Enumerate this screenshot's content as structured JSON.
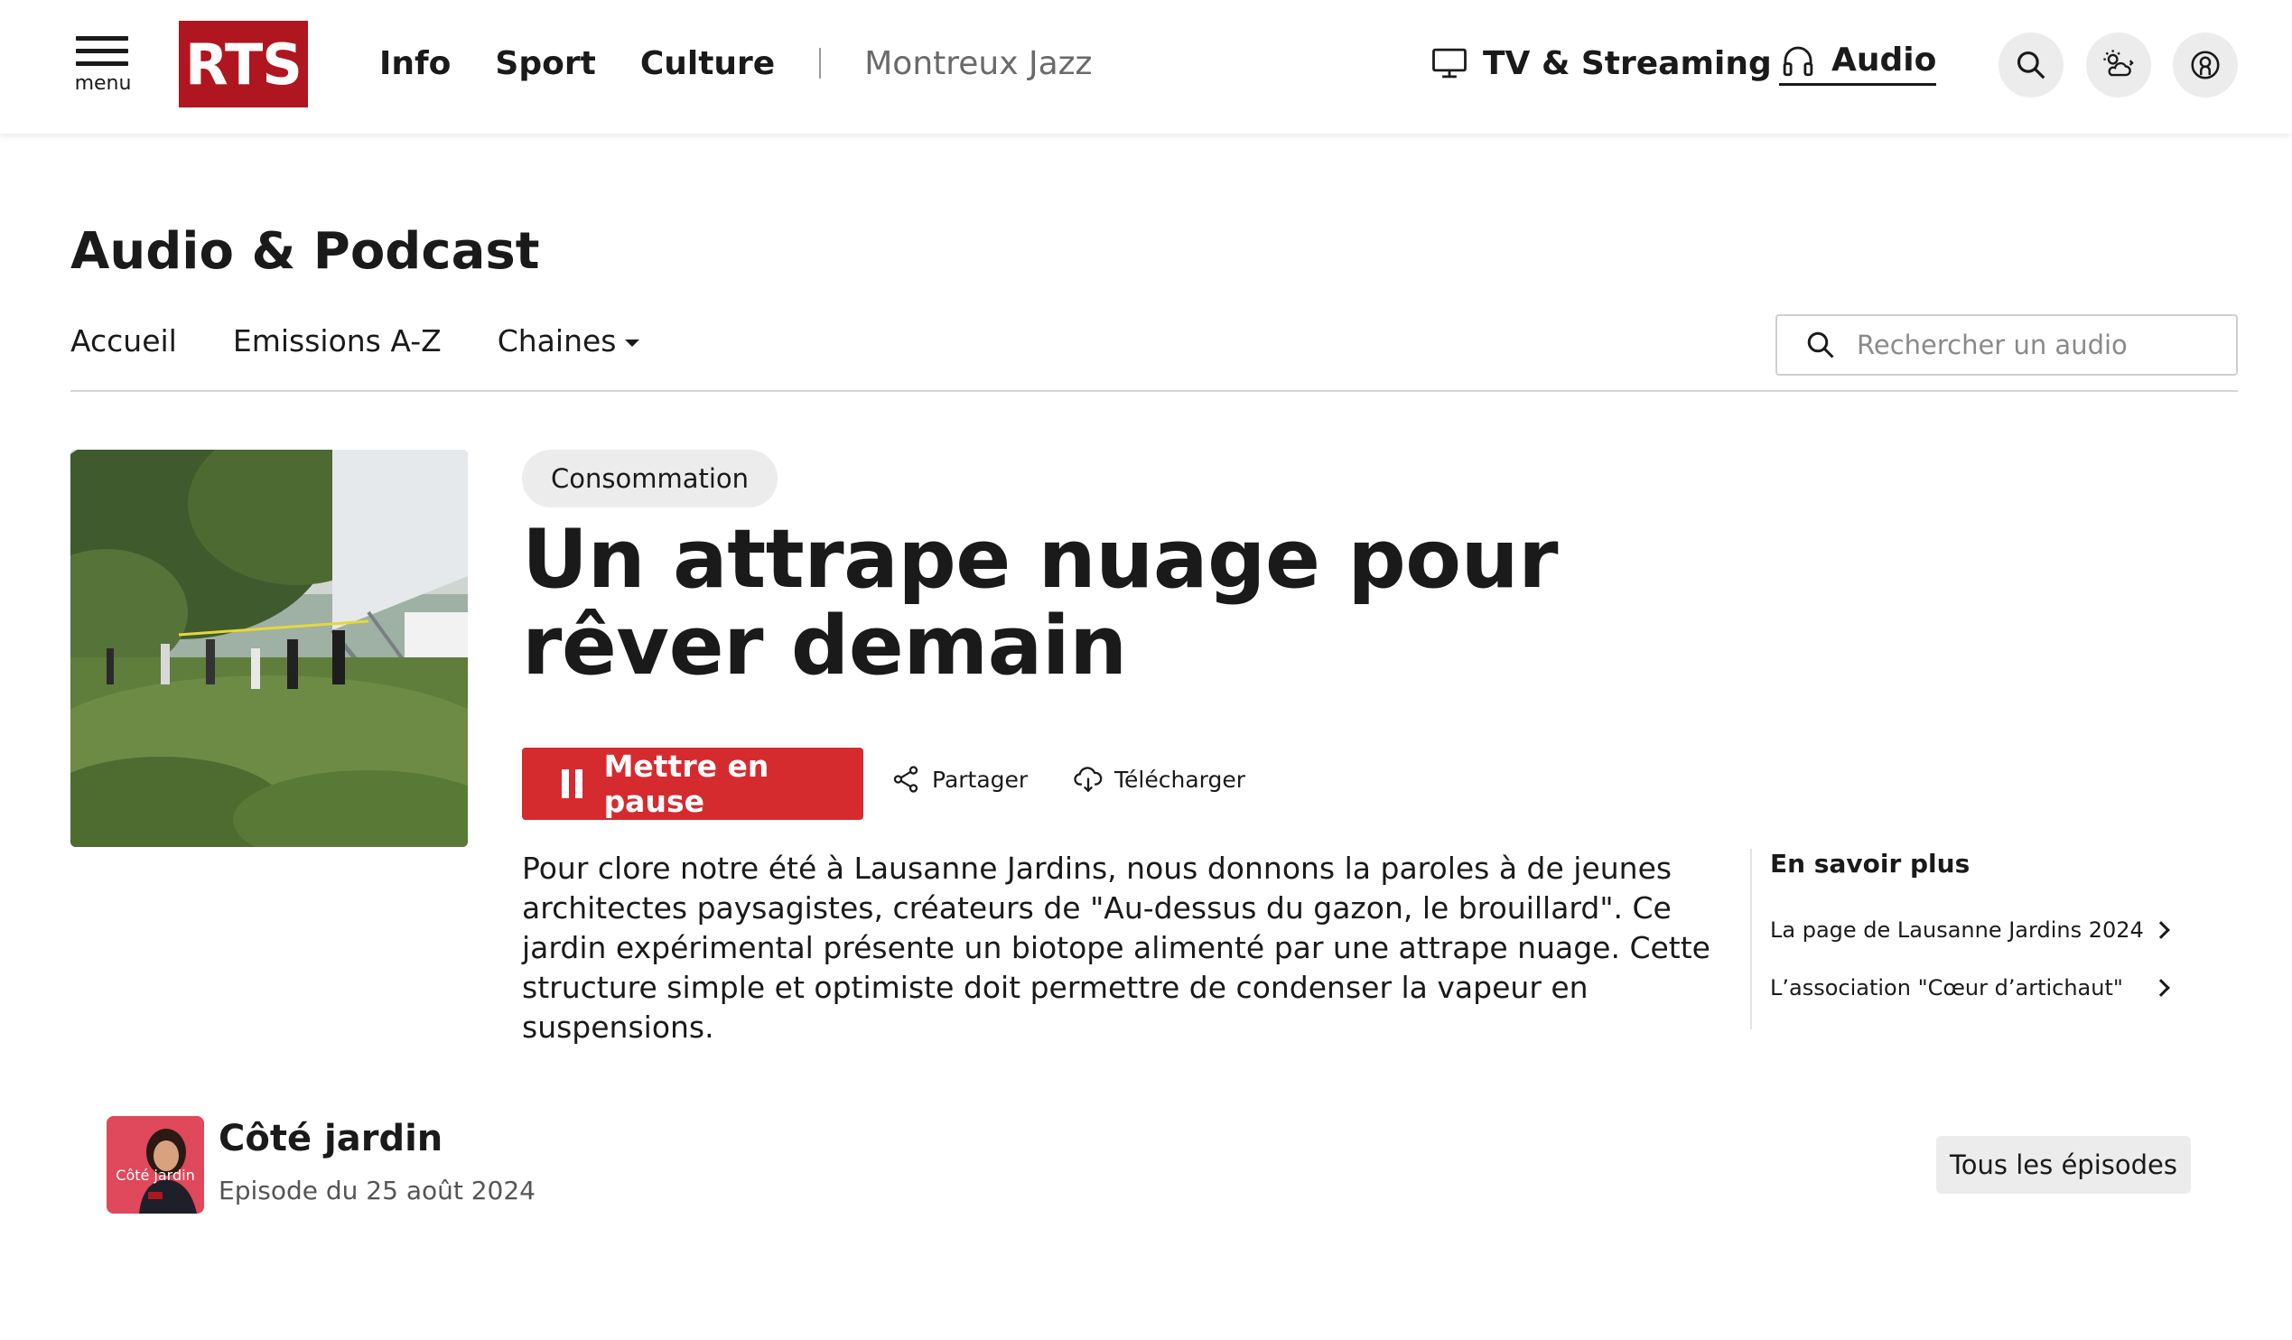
{
  "header": {
    "menu_label": "menu",
    "logo_text": "RTS",
    "nav": [
      {
        "label": "Info"
      },
      {
        "label": "Sport"
      },
      {
        "label": "Culture"
      }
    ],
    "special_link": "Montreux Jazz",
    "tv_label": "TV & Streaming",
    "audio_label": "Audio",
    "brand_color": "#b0161f"
  },
  "section": {
    "title": "Audio & Podcast",
    "subnav": [
      {
        "label": "Accueil"
      },
      {
        "label": "Emissions A-Z"
      },
      {
        "label": "Chaines"
      }
    ],
    "search_placeholder": "Rechercher un audio"
  },
  "episode": {
    "tag": "Consommation",
    "title": "Un attrape nuage pour rêver demain",
    "pause_label": "Mettre en pause",
    "share_label": "Partager",
    "download_label": "Télécharger",
    "description": "Pour clore notre été à Lausanne Jardins, nous donnons la paroles à de jeunes architectes paysagistes, créateurs de \"Au-dessus du gazon, le brouillard\". Ce jardin expérimental présente un biotope alimenté par une attrape nuage. Cette structure simple et optimiste doit permettre de condenser la vapeur en suspensions.",
    "accent_color": "#d52b2f"
  },
  "more": {
    "title": "En savoir plus",
    "links": [
      {
        "label": "La page de Lausanne Jardins 2024"
      },
      {
        "label": "L’association \"Cœur d’artichaut\""
      }
    ]
  },
  "show": {
    "thumb_text": "Côté jardin",
    "name": "Côté jardin",
    "date": "Episode du 25 août 2024",
    "all_episodes_label": "Tous les épisodes"
  }
}
